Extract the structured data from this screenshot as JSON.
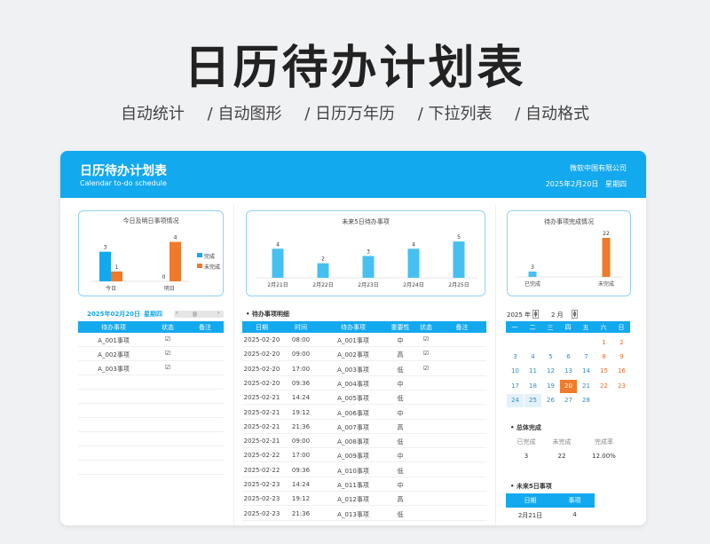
{
  "hero": {
    "title": "日历待办计划表",
    "features": [
      "自动统计",
      "/ 自动图形",
      "/ 日历万年历",
      "/ 下拉列表",
      "/ 自动格式"
    ]
  },
  "header": {
    "title": "日历待办计划表",
    "subtitle": "Calendar to-do schedule",
    "company": "微软中国有限公司",
    "date": "2025年2月20日",
    "weekday": "星期四"
  },
  "colors": {
    "accent": "#13a9ee",
    "orange": "#ef7a2a",
    "check": "#2db36a"
  },
  "left": {
    "chart_title": "今日及明日事项情况",
    "legend": [
      "完成",
      "未完成"
    ],
    "date_label": "2025年02月20日",
    "weekday_label": "星期四",
    "table_headers": [
      "待办事项",
      "状态",
      "备注"
    ],
    "rows": [
      {
        "item": "A_001事项",
        "status": "☑",
        "note": ""
      },
      {
        "item": "A_002事项",
        "status": "☑",
        "note": ""
      },
      {
        "item": "A_003事项",
        "status": "☑",
        "note": ""
      }
    ]
  },
  "middle": {
    "chart_title": "未来5日待办事项",
    "detail_title": "待办事项明细",
    "table_headers": [
      "日期",
      "时间",
      "待办事项",
      "重要性",
      "状态",
      "备注"
    ],
    "rows": [
      {
        "date": "2025-02-20",
        "time": "08:00",
        "item": "A_001事项",
        "imp": "中",
        "status": "☑",
        "note": ""
      },
      {
        "date": "2025-02-20",
        "time": "09:00",
        "item": "A_002事项",
        "imp": "高",
        "status": "☑",
        "note": ""
      },
      {
        "date": "2025-02-20",
        "time": "17:00",
        "item": "A_003事项",
        "imp": "低",
        "status": "☑",
        "note": ""
      },
      {
        "date": "2025-02-20",
        "time": "09:36",
        "item": "A_004事项",
        "imp": "中",
        "status": "",
        "note": ""
      },
      {
        "date": "2025-02-21",
        "time": "14:24",
        "item": "A_005事项",
        "imp": "低",
        "status": "",
        "note": ""
      },
      {
        "date": "2025-02-21",
        "time": "19:12",
        "item": "A_006事项",
        "imp": "中",
        "status": "",
        "note": ""
      },
      {
        "date": "2025-02-21",
        "time": "21:36",
        "item": "A_007事项",
        "imp": "高",
        "status": "",
        "note": ""
      },
      {
        "date": "2025-02-21",
        "time": "09:00",
        "item": "A_008事项",
        "imp": "低",
        "status": "",
        "note": ""
      },
      {
        "date": "2025-02-22",
        "time": "17:00",
        "item": "A_009事项",
        "imp": "中",
        "status": "",
        "note": ""
      },
      {
        "date": "2025-02-22",
        "time": "09:36",
        "item": "A_010事项",
        "imp": "低",
        "status": "",
        "note": ""
      },
      {
        "date": "2025-02-23",
        "time": "14:24",
        "item": "A_011事项",
        "imp": "中",
        "status": "",
        "note": ""
      },
      {
        "date": "2025-02-23",
        "time": "19:12",
        "item": "A_012事项",
        "imp": "高",
        "status": "",
        "note": ""
      },
      {
        "date": "2025-02-23",
        "time": "21:36",
        "item": "A_013事项",
        "imp": "低",
        "status": "",
        "note": ""
      }
    ]
  },
  "right": {
    "chart_title": "待办事项完成情况",
    "year_label": "2025 年",
    "month_label": "2 月",
    "weekdays": [
      "一",
      "二",
      "三",
      "四",
      "五",
      "六",
      "日"
    ],
    "calendar": [
      [
        "",
        "",
        "",
        "",
        "",
        "1",
        "2"
      ],
      [
        "3",
        "4",
        "5",
        "6",
        "7",
        "8",
        "9"
      ],
      [
        "10",
        "11",
        "12",
        "13",
        "14",
        "15",
        "16"
      ],
      [
        "17",
        "18",
        "19",
        "20",
        "21",
        "22",
        "23"
      ],
      [
        "24",
        "25",
        "26",
        "27",
        "28",
        "",
        ""
      ]
    ],
    "summary_title": "总体完成",
    "summary_headers": [
      "已完成",
      "未完成",
      "完成率"
    ],
    "summary_values": [
      "3",
      "22",
      "12.00%"
    ],
    "future_title": "未来5日事项",
    "future_headers": [
      "日期",
      "事项"
    ],
    "future_row": [
      "2月21日",
      "4"
    ]
  },
  "chart_data": [
    {
      "type": "bar",
      "title": "今日及明日事项情况",
      "categories": [
        "今日",
        "明日"
      ],
      "series": [
        {
          "name": "完成",
          "values": [
            3,
            0
          ]
        },
        {
          "name": "未完成",
          "values": [
            1,
            4
          ]
        }
      ],
      "ylim": [
        0,
        4.5
      ]
    },
    {
      "type": "bar",
      "title": "未来5日待办事项",
      "categories": [
        "2月21日",
        "2月22日",
        "2月23日",
        "2月24日",
        "2月25日"
      ],
      "values": [
        4,
        2,
        3,
        4,
        5
      ],
      "ylim": [
        0,
        5.5
      ]
    },
    {
      "type": "bar",
      "title": "待办事项完成情况",
      "categories": [
        "已完成",
        "未完成"
      ],
      "values": [
        3,
        22
      ],
      "ylim": [
        0,
        24
      ]
    }
  ]
}
